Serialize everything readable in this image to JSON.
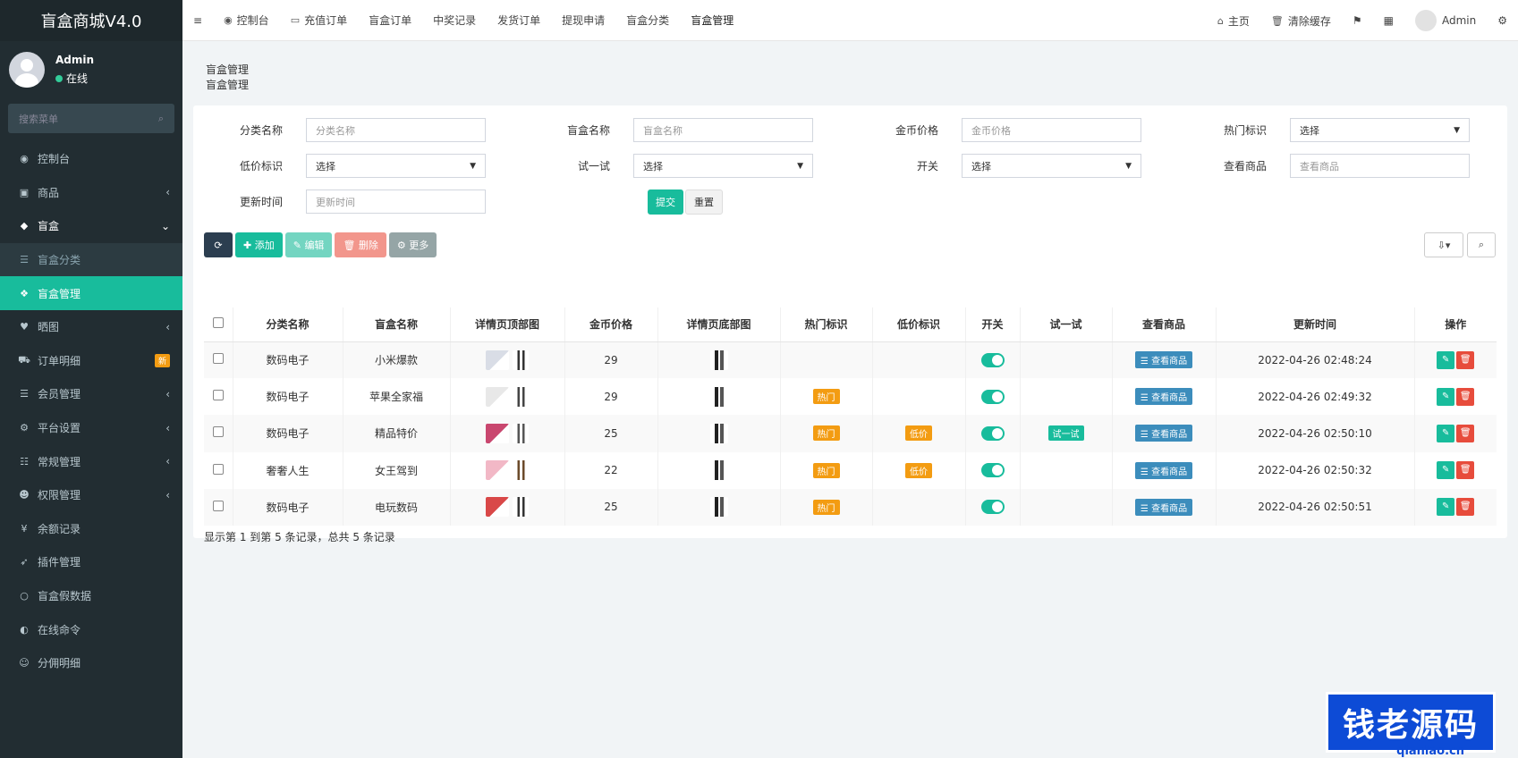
{
  "app_title": "盲盒商城V4.0",
  "user": {
    "name": "Admin",
    "status": "在线"
  },
  "sidebar": {
    "search_placeholder": "搜索菜单",
    "items": [
      {
        "label": "控制台",
        "icon": "dashboard-icon"
      },
      {
        "label": "商品",
        "icon": "cube-icon",
        "arrow": "‹"
      },
      {
        "label": "盲盒",
        "icon": "box-icon",
        "arrow": "⌄"
      },
      {
        "label": "盲盒分类",
        "icon": "list-icon"
      },
      {
        "label": "盲盒管理",
        "icon": "cubes-icon"
      },
      {
        "label": "晒图",
        "icon": "heart-icon",
        "arrow": "‹"
      },
      {
        "label": "订单明细",
        "icon": "cart-icon",
        "badge": "新"
      },
      {
        "label": "会员管理",
        "icon": "list-icon",
        "arrow": "‹"
      },
      {
        "label": "平台设置",
        "icon": "gear-icon",
        "arrow": "‹"
      },
      {
        "label": "常规管理",
        "icon": "database-icon",
        "arrow": "‹"
      },
      {
        "label": "权限管理",
        "icon": "group-icon",
        "arrow": "‹"
      },
      {
        "label": "余额记录",
        "icon": "yen-icon"
      },
      {
        "label": "插件管理",
        "icon": "rocket-icon"
      },
      {
        "label": "盲盒假数据",
        "icon": "circle-icon"
      },
      {
        "label": "在线命令",
        "icon": "half-circle-icon"
      },
      {
        "label": "分佣明细",
        "icon": "users-icon"
      }
    ]
  },
  "topbar": {
    "menu_icon": "≡",
    "tabs": [
      {
        "label": "控制台",
        "icon": "dashboard-icon"
      },
      {
        "label": "充值订单",
        "icon": "battery-icon"
      },
      {
        "label": "盲盒订单"
      },
      {
        "label": "中奖记录"
      },
      {
        "label": "发货订单"
      },
      {
        "label": "提现申请"
      },
      {
        "label": "盲盒分类"
      },
      {
        "label": "盲盒管理"
      }
    ],
    "home": "主页",
    "clear_cache": "清除缓存",
    "admin": "Admin"
  },
  "breadcrumb": {
    "title": "盲盒管理",
    "sub": "盲盒管理"
  },
  "filters": {
    "category_label": "分类名称",
    "category_placeholder": "分类名称",
    "box_label": "盲盒名称",
    "box_placeholder": "盲盒名称",
    "price_label": "金币价格",
    "price_placeholder": "金币价格",
    "hot_label": "热门标识",
    "hot_value": "选择",
    "low_label": "低价标识",
    "low_value": "选择",
    "try_label": "试一试",
    "try_value": "选择",
    "switch_label": "开关",
    "switch_value": "选择",
    "goods_label": "查看商品",
    "goods_placeholder": "查看商品",
    "time_label": "更新时间",
    "time_placeholder": "更新时间",
    "submit": "提交",
    "reset": "重置"
  },
  "toolbar": {
    "refresh": "⟳",
    "add": "添加",
    "edit": "编辑",
    "delete": "删除",
    "more": "更多"
  },
  "table": {
    "headers": [
      "分类名称",
      "盲盒名称",
      "详情页顶部图",
      "金币价格",
      "详情页底部图",
      "热门标识",
      "低价标识",
      "开关",
      "试一试",
      "查看商品",
      "更新时间",
      "操作"
    ],
    "rows": [
      {
        "category": "数码电子",
        "name": "小米爆款",
        "price": "29",
        "hot": "",
        "low": "",
        "try": "",
        "goods": "查看商品",
        "time": "2022-04-26 02:48:24"
      },
      {
        "category": "数码电子",
        "name": "苹果全家福",
        "price": "29",
        "hot": "热门",
        "low": "",
        "try": "",
        "goods": "查看商品",
        "time": "2022-04-26 02:49:32"
      },
      {
        "category": "数码电子",
        "name": "精品特价",
        "price": "25",
        "hot": "热门",
        "low": "低价",
        "try": "试一试",
        "goods": "查看商品",
        "time": "2022-04-26 02:50:10"
      },
      {
        "category": "奢奢人生",
        "name": "女王驾到",
        "price": "22",
        "hot": "热门",
        "low": "低价",
        "try": "",
        "goods": "查看商品",
        "time": "2022-04-26 02:50:32"
      },
      {
        "category": "数码电子",
        "name": "电玩数码",
        "price": "25",
        "hot": "热门",
        "low": "",
        "try": "",
        "goods": "查看商品",
        "time": "2022-04-26 02:50:51"
      }
    ]
  },
  "pager": "显示第 1 到第 5 条记录，总共 5 条记录",
  "watermark": {
    "text": "钱老源码",
    "url": "qianlao.cn"
  },
  "colors": {
    "sidebar": "#222d32",
    "accent": "#18bc9c",
    "tag": "#f39c12",
    "view": "#3c8dbc",
    "danger": "#e74c3c"
  }
}
